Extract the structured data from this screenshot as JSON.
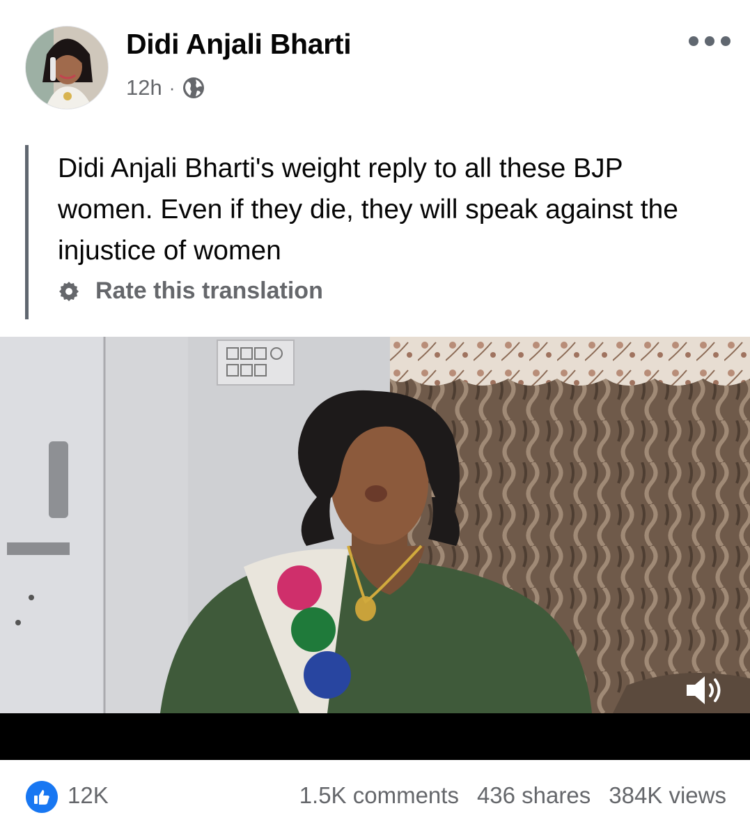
{
  "post": {
    "author": "Didi Anjali Bharti",
    "time": "12h",
    "separator": "·",
    "privacy_icon": "globe-icon",
    "menu_icon": "more-options-icon",
    "text": "Didi Anjali Bharti's weight reply to all these BJP women. Even if they die, they will speak against the injustice of women",
    "rate_translation": "Rate this translation"
  },
  "video": {
    "sound_icon": "volume-icon"
  },
  "footer": {
    "like_icon": "like-icon",
    "likes": "12K",
    "comments": "1.5K comments",
    "shares": "436 shares",
    "views": "384K views"
  },
  "colors": {
    "accent": "#1877f2",
    "secondary_text": "#65676b",
    "primary_text": "#050505"
  }
}
